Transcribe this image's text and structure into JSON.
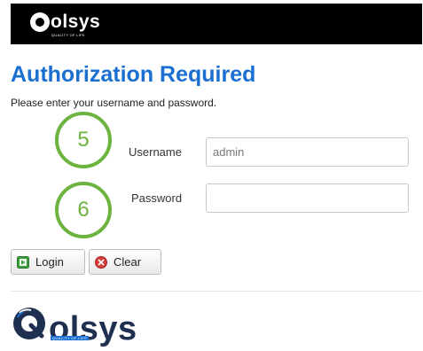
{
  "header": {
    "brand": "olsys",
    "brand_subtitle": "QUALITY OF LIFE"
  },
  "main": {
    "title": "Authorization Required",
    "instructions": "Please enter your username and password.",
    "callouts": [
      "5",
      "6"
    ],
    "username": {
      "label": "Username",
      "value": "admin"
    },
    "password": {
      "label": "Password",
      "value": ""
    },
    "buttons": {
      "login_label": "Login",
      "clear_label": "Clear"
    }
  },
  "footer": {
    "brand": "olsys",
    "brand_subtitle": "QUALITY OF LIFE"
  },
  "colors": {
    "heading": "#1a6fd1",
    "callout": "#6cb33f",
    "topbar": "#000000",
    "login_icon": "#3c9c3c",
    "clear_icon": "#d93a3a"
  },
  "icons": {
    "login": "login-icon",
    "clear": "clear-icon"
  }
}
